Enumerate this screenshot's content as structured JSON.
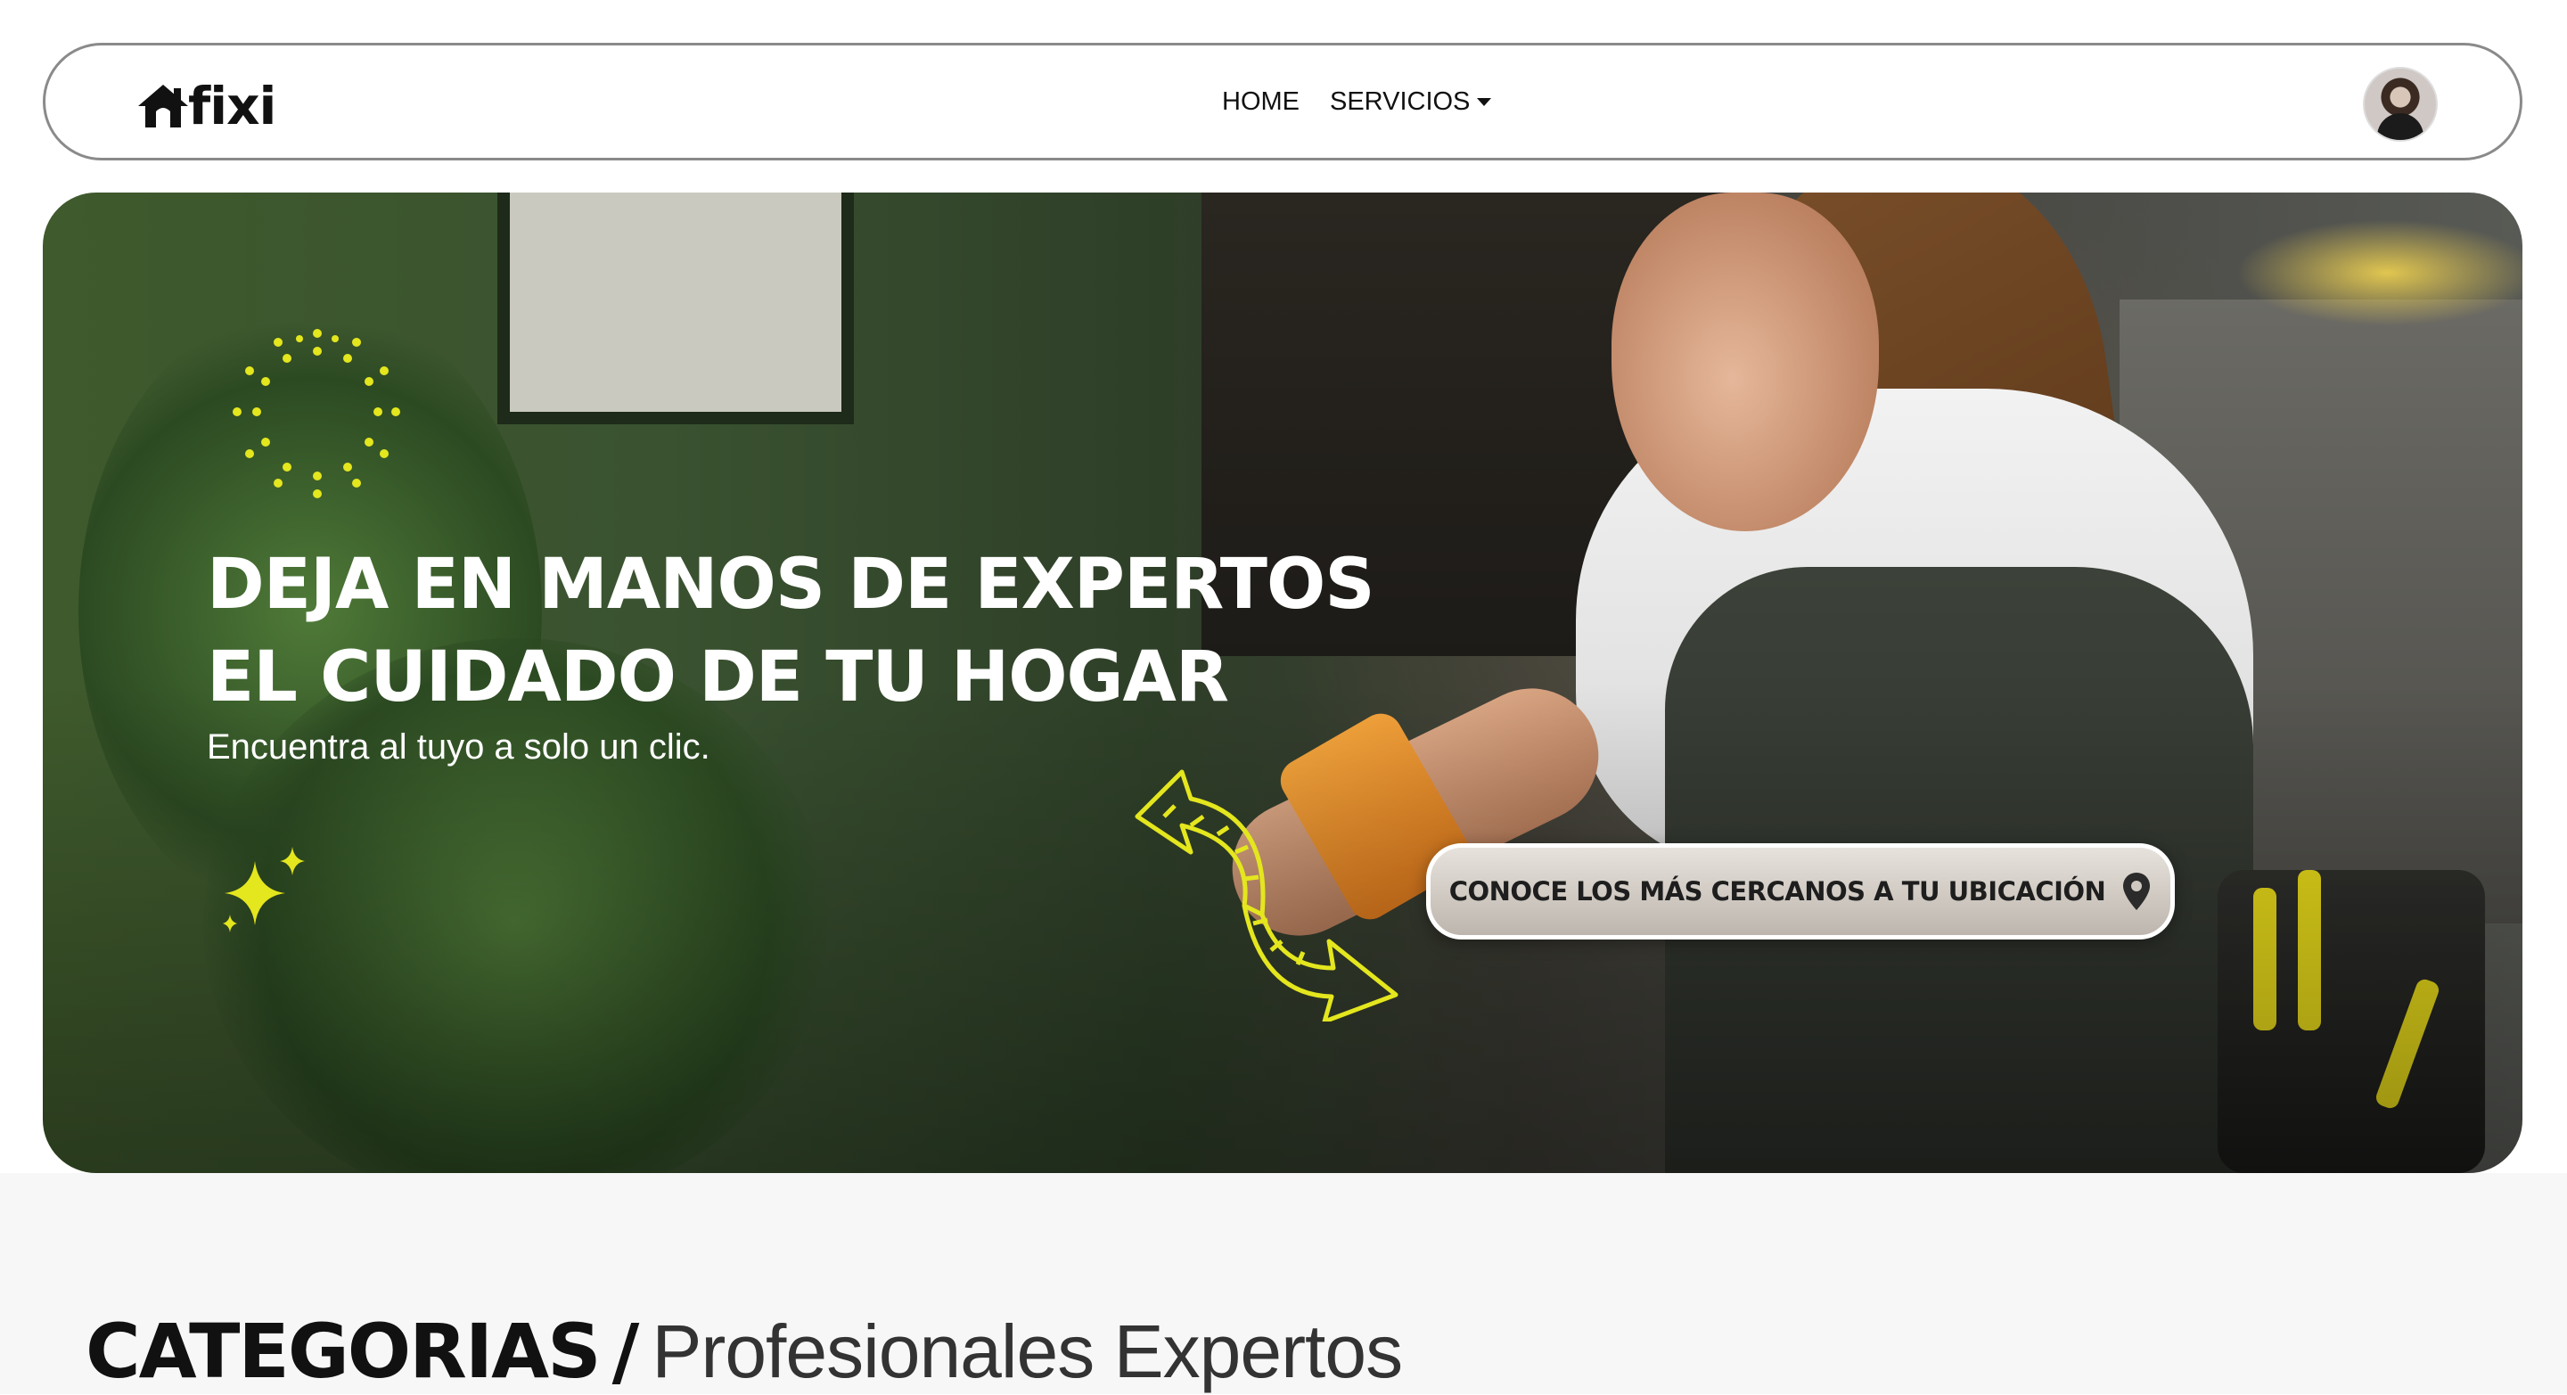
{
  "navbar": {
    "logo_text": "fixi",
    "links": [
      {
        "label": "HOME"
      },
      {
        "label": "SERVICIOS"
      }
    ]
  },
  "hero": {
    "title_line1": "DEJA EN MANOS DE EXPERTOS",
    "title_line2": "EL CUIDADO DE TU HOGAR",
    "subtitle": "Encuentra al tuyo a solo un clic.",
    "cta_label": "CONOCE LOS MÁS CERCANOS A TU UBICACIÓN",
    "accent_color": "#e4e61e"
  },
  "categories": {
    "title_strong": "CATEGORIAS",
    "separator": "/",
    "title_light": "Profesionales Expertos"
  },
  "icons": [
    "house-logo-icon",
    "chevron-down-icon",
    "avatar",
    "burst-icon",
    "sparkle-icon",
    "arrow-icon",
    "map-pin-icon"
  ]
}
